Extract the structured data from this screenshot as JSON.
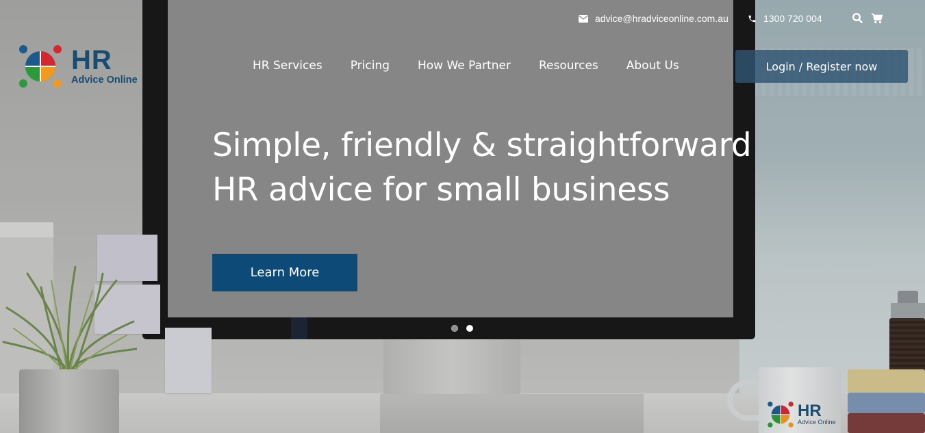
{
  "topbar": {
    "email": "advice@hradviceonline.com.au",
    "phone": "1300 720 004",
    "icons": [
      "envelope-icon",
      "phone-icon",
      "search-icon",
      "cart-icon"
    ]
  },
  "logo": {
    "title": "HR",
    "subtitle": "Advice Online",
    "colors": [
      "#1a5a8c",
      "#d6262f",
      "#2a9a3a",
      "#f29a1f"
    ]
  },
  "nav": {
    "items": [
      "HR Services",
      "Pricing",
      "How We Partner",
      "Resources",
      "About Us"
    ],
    "login_label": "Login / Register now"
  },
  "hero": {
    "line1": "Simple, friendly & straightforward",
    "line2": "HR advice for small business",
    "cta_label": "Learn More",
    "slides_total": 2,
    "active_slide": 2
  },
  "mug_logo": {
    "title": "HR",
    "subtitle": "Advice Online"
  },
  "colors": {
    "brand_blue": "#0d4a78",
    "login_bg": "#2f5472",
    "text_white": "#ffffff"
  }
}
